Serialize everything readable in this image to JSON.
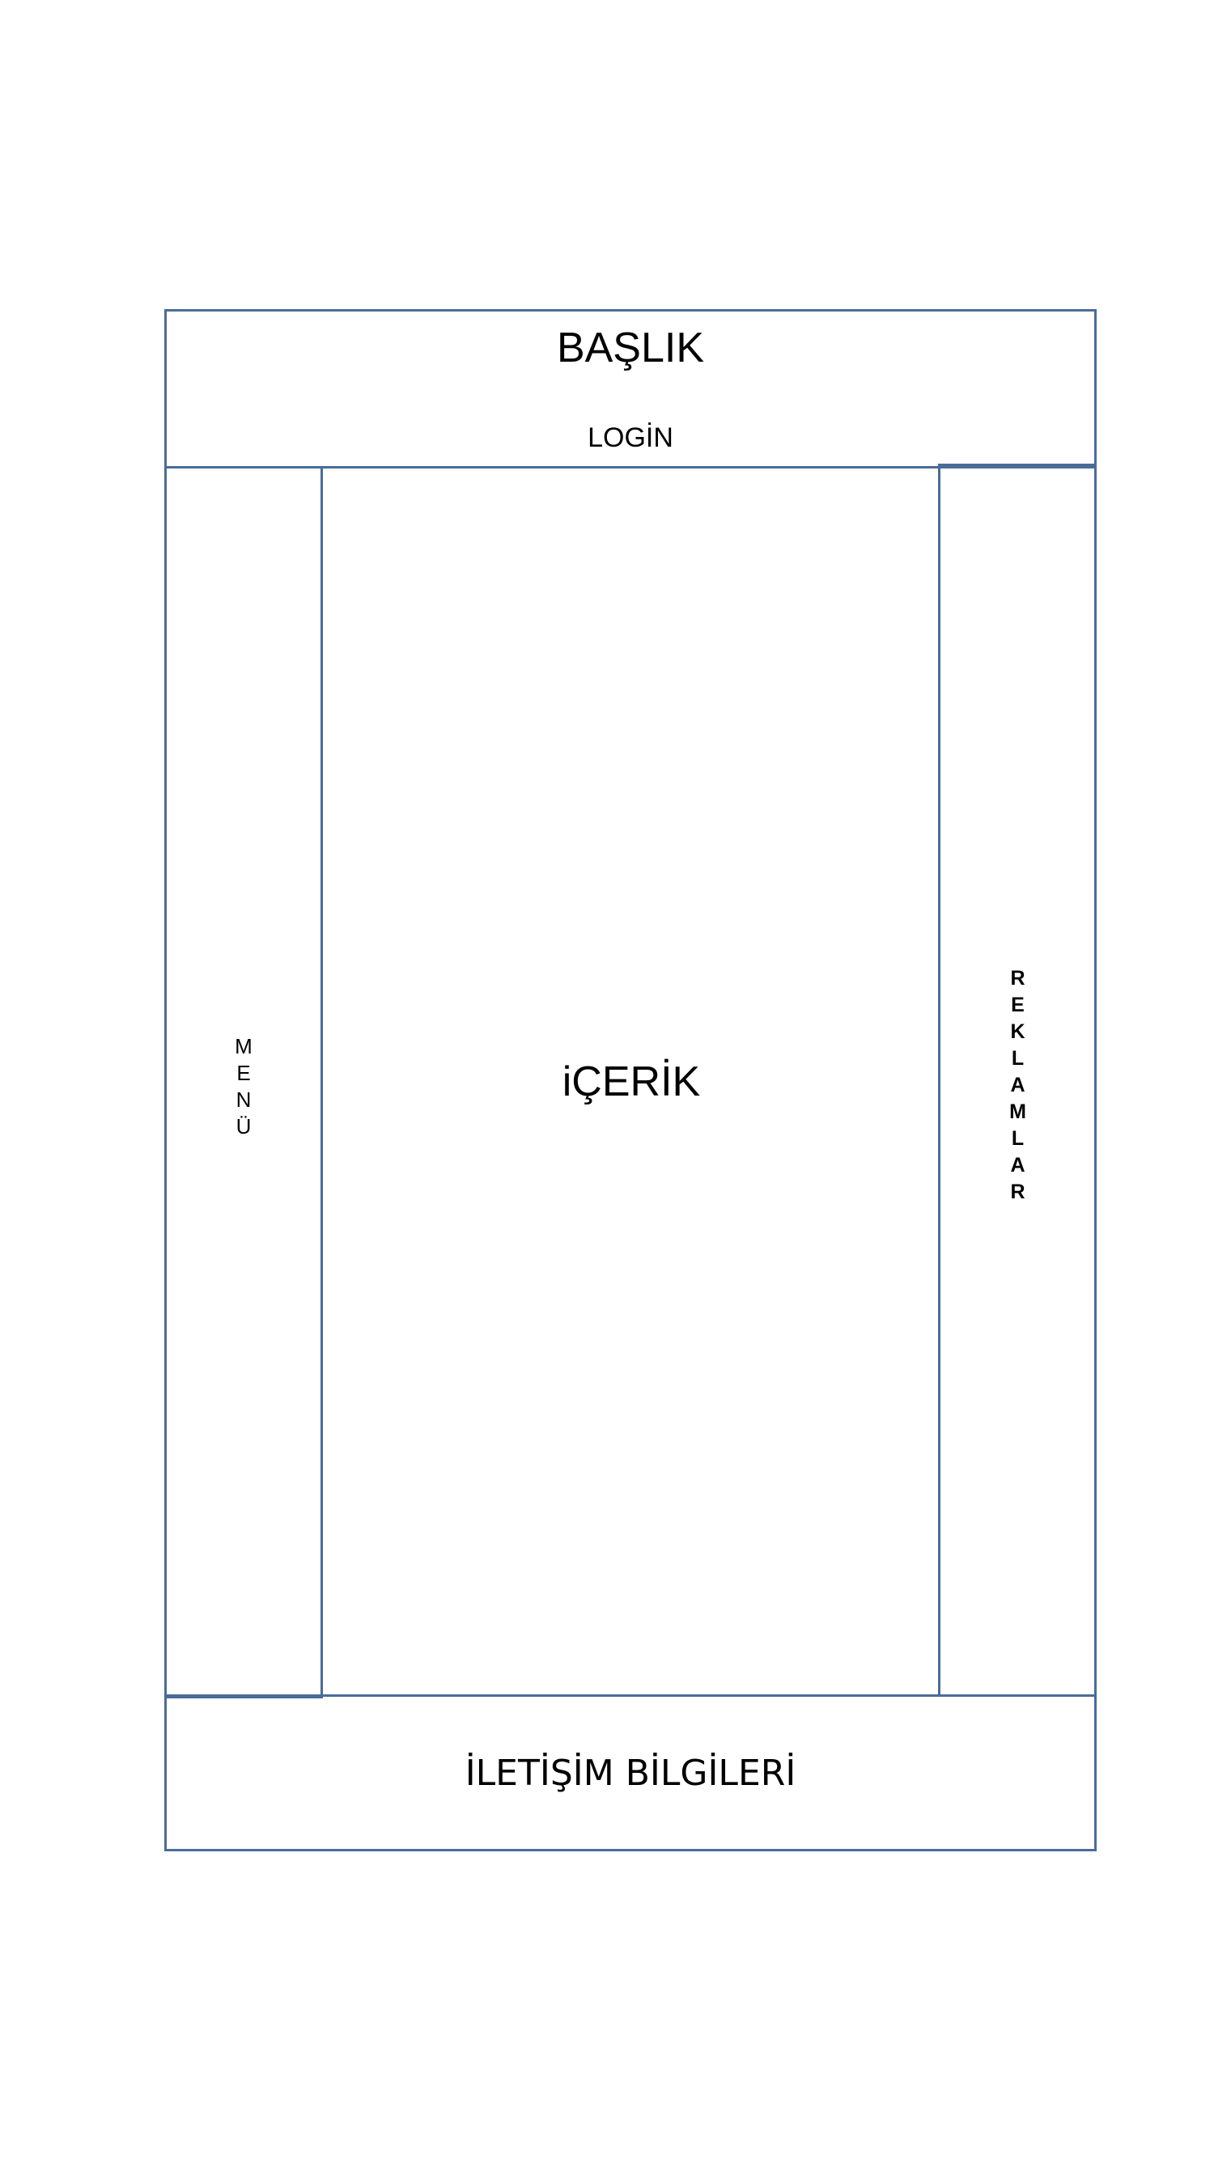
{
  "header": {
    "title": "BAŞLIK",
    "login": "LOGİN"
  },
  "menu": {
    "letters": [
      "M",
      "E",
      "N",
      "Ü"
    ]
  },
  "content": {
    "label": "iÇERİK"
  },
  "ads": {
    "letters": [
      "R",
      "E",
      "K",
      "L",
      "A",
      "M",
      "L",
      "A",
      "R"
    ]
  },
  "footer": {
    "label": "İLETİŞİM BİLGİLERİ"
  },
  "colors": {
    "border": "#4a6c98",
    "text": "#000000",
    "background": "#ffffff"
  }
}
